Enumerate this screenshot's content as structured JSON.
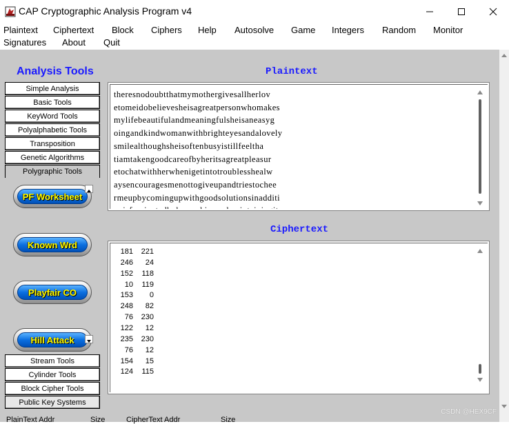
{
  "window": {
    "title": "CAP  Cryptographic Analysis Program v4"
  },
  "menu": {
    "items": [
      "Plaintext",
      "Ciphertext",
      "Block",
      "Ciphers",
      "Help",
      "Autosolve",
      "Game",
      "Integers",
      "Random",
      "Monitor",
      "Signatures",
      "About",
      "Quit"
    ]
  },
  "analysis": {
    "heading": "Analysis Tools",
    "top_tools": [
      "Simple Analysis",
      "Basic Tools",
      "KeyWord Tools",
      "Polyalphabetic Tools",
      "Transposition",
      "Genetic Algorithms",
      "Polygraphic Tools"
    ],
    "active_tool": "Polygraphic Tools",
    "bottom_tools": [
      "Stream Tools",
      "Cylinder Tools",
      "Block Cipher Tools",
      "Public Key Systems"
    ],
    "pill_buttons": [
      "PF Worksheet",
      "Known Wrd",
      "Playfair CO",
      "Hill Attack"
    ]
  },
  "plaintext": {
    "title": "Plaintext",
    "lines": [
      "theresnodoubtthatmymothergivesallherlov",
      "etomeidobelievesheisagreatpersonwhomakes",
      "mylifebeautifulandmeaningfulsheisaneasyg",
      "oingandkindwomanwithbrighteyesandalovely",
      "smilealthoughsheisoftenbusyistillfeeltha",
      "tiamtakengoodcareofbyheritsagreatpleasur",
      "etochatwithherwhenigetintotroublesshealw",
      "aysencouragesmenottogiveupandtriestochee",
      "rmeupbycomingupwithgoodsolutionsinadditi",
      "onisfascinatedbyhomeskinsandmaintainingit"
    ]
  },
  "ciphertext": {
    "title": "Ciphertext",
    "rows": [
      [
        "181",
        "221"
      ],
      [
        "246",
        "24"
      ],
      [
        "152",
        "118"
      ],
      [
        "10",
        "119"
      ],
      [
        "153",
        "0"
      ],
      [
        "248",
        "82"
      ],
      [
        "76",
        "230"
      ],
      [
        "122",
        "12"
      ],
      [
        "235",
        "230"
      ],
      [
        "76",
        "12"
      ],
      [
        "154",
        "15"
      ],
      [
        "124",
        "115"
      ]
    ]
  },
  "statusbar": {
    "labels": [
      "PlainText Addr",
      "Size",
      "CipherText Addr",
      "Size"
    ]
  },
  "watermark": "CSDN @HEX9CF",
  "colors": {
    "heading_blue": "#1a1aff",
    "pill_text": "#ffff00",
    "pill_blue": "#0b6fe0",
    "client_gray": "#c8c8c8"
  }
}
